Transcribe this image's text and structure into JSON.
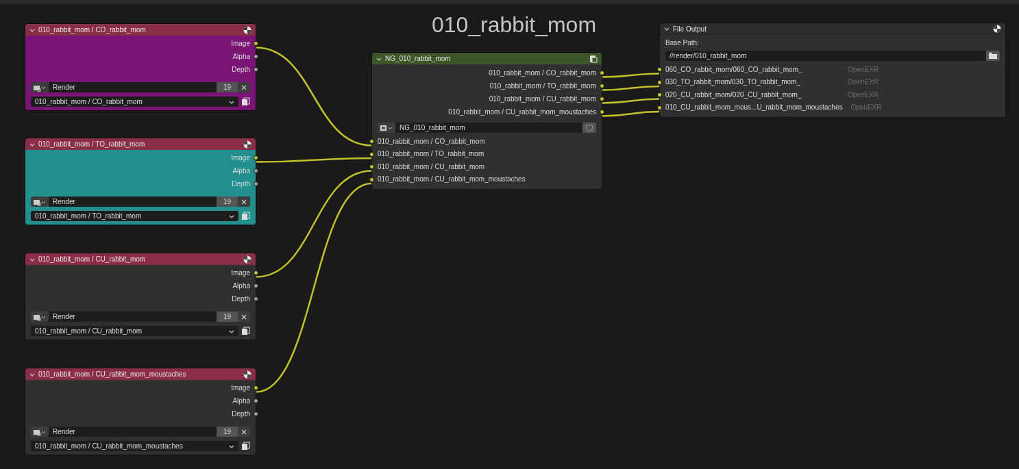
{
  "frame_title": "010_rabbit_mom",
  "render_layer_nodes": [
    {
      "title": "010_rabbit_mom / CO_rabbit_mom",
      "color": "#7b1575",
      "outputs": [
        {
          "name": "Image",
          "kind": "color"
        },
        {
          "name": "Alpha",
          "kind": "value"
        },
        {
          "name": "Depth",
          "kind": "value"
        }
      ],
      "scene": "Render",
      "number": "19",
      "layer": "010_rabbit_mom / CO_rabbit_mom"
    },
    {
      "title": "010_rabbit_mom / TO_rabbit_mom",
      "color": "#22908f",
      "outputs": [
        {
          "name": "Image",
          "kind": "color"
        },
        {
          "name": "Alpha",
          "kind": "value"
        },
        {
          "name": "Depth",
          "kind": "value"
        }
      ],
      "scene": "Render",
      "number": "19",
      "layer": "010_rabbit_mom / TO_rabbit_mom"
    },
    {
      "title": "010_rabbit_mom / CU_rabbit_mom",
      "color": "#303030",
      "outputs": [
        {
          "name": "Image",
          "kind": "color"
        },
        {
          "name": "Alpha",
          "kind": "value"
        },
        {
          "name": "Depth",
          "kind": "value"
        }
      ],
      "scene": "Render",
      "number": "19",
      "layer": "010_rabbit_mom / CU_rabbit_mom"
    },
    {
      "title": "010_rabbit_mom / CU_rabbit_mom_moustaches",
      "color": "#303030",
      "outputs": [
        {
          "name": "Image",
          "kind": "color"
        },
        {
          "name": "Alpha",
          "kind": "value"
        },
        {
          "name": "Depth",
          "kind": "value"
        }
      ],
      "scene": "Render",
      "number": "19",
      "layer": "010_rabbit_mom / CU_rabbit_mom_moustaches"
    }
  ],
  "group_node": {
    "title": "NG_010_rabbit_mom",
    "outputs": [
      {
        "name": "010_rabbit_mom / CO_rabbit_mom",
        "linked": true
      },
      {
        "name": "010_rabbit_mom / TO_rabbit_mom",
        "linked": true
      },
      {
        "name": "010_rabbit_mom / CU_rabbit_mom",
        "linked": true
      },
      {
        "name": "010_rabbit_mom / CU_rabbit_mom_moustaches",
        "linked": true
      }
    ],
    "group_name": "NG_010_rabbit_mom",
    "inputs": [
      {
        "name": "010_rabbit_mom / CO_rabbit_mom",
        "linked": true
      },
      {
        "name": "010_rabbit_mom / TO_rabbit_mom",
        "linked": true
      },
      {
        "name": "010_rabbit_mom / CU_rabbit_mom",
        "linked": true
      },
      {
        "name": "010_rabbit_mom / CU_rabbit_mom_moustaches",
        "linked": true
      }
    ]
  },
  "file_output_node": {
    "title": "File Output",
    "base_path_label": "Base Path:",
    "base_path": "//render/010_rabbit_mom",
    "inputs": [
      {
        "name": "060_CO_rabbit_mom/060_CO_rabbit_mom_",
        "format": "OpenEXR",
        "linked": true
      },
      {
        "name": "030_TO_rabbit_mom/030_TO_rabbit_mom_",
        "format": "OpenEXR",
        "linked": true
      },
      {
        "name": "020_CU_rabbit_mom/020_CU_rabbit_mom_",
        "format": "OpenEXR",
        "linked": true
      },
      {
        "name": "010_CU_rabbit_mom_mous...U_rabbit_mom_moustaches",
        "format": "OpenEXR",
        "linked": true
      }
    ]
  }
}
